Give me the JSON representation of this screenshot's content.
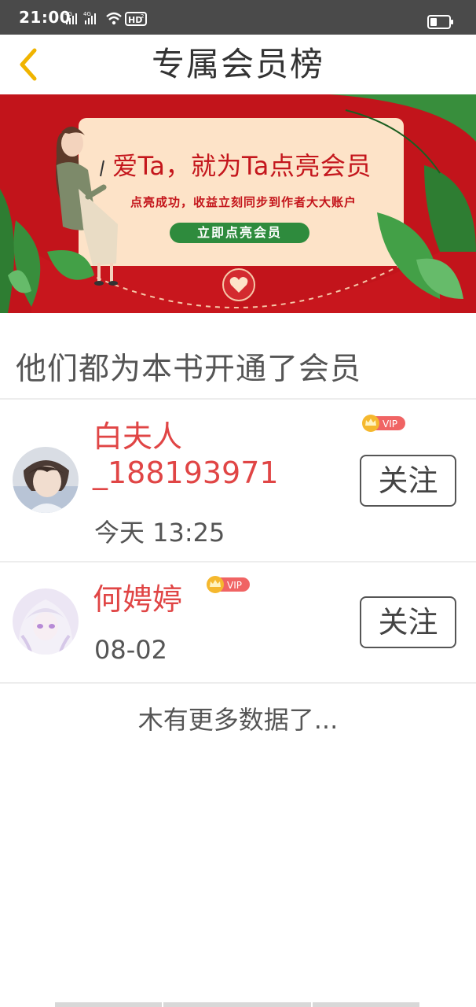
{
  "status_bar": {
    "time": "21:00",
    "network_1": "4G",
    "network_2": "4G",
    "hd_label": "HD",
    "hd_sub": "2"
  },
  "header": {
    "title": "专属会员榜",
    "back_icon": "chevron-left-icon",
    "accent_color": "#f0b400"
  },
  "banner": {
    "headline": "爱Ta，就为Ta点亮会员",
    "subtext": "点亮成功，收益立刻同步到作者大大账户",
    "cta_label": "立即点亮会员",
    "bg_color": "#c8161d"
  },
  "section_title": "他们都为本书开通了会员",
  "members": [
    {
      "name": "白夫人_188193971",
      "name_line1": "白夫人",
      "name_line2": "_188193971",
      "time": "今天 13:25",
      "vip_label": "VIP",
      "follow_label": "关注",
      "avatar_icon": "male-avatar"
    },
    {
      "name": "何娉婷",
      "time": "08-02",
      "vip_label": "VIP",
      "follow_label": "关注",
      "avatar_icon": "female-avatar"
    }
  ],
  "footer_text": "木有更多数据了..."
}
